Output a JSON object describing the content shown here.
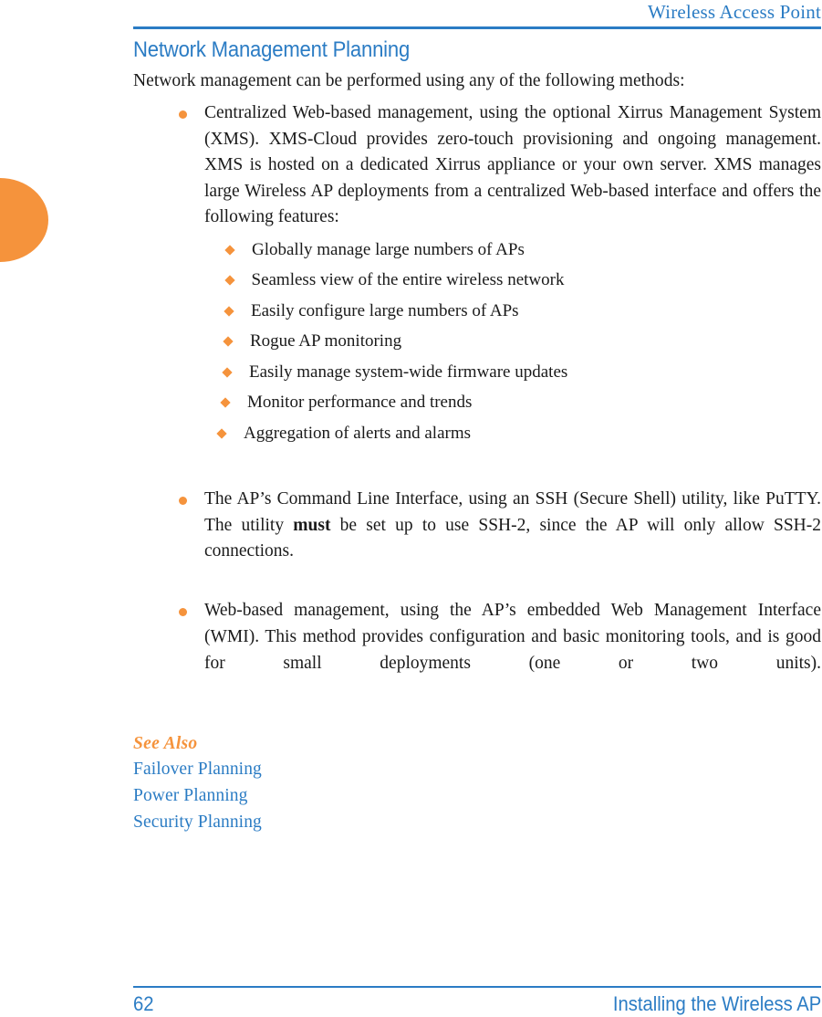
{
  "header": {
    "running_title": "Wireless Access Point"
  },
  "section": {
    "title": "Network Management Planning",
    "intro": "Network management can be performed using any of the following methods:"
  },
  "bullets": [
    {
      "text_before_bold": "Centralized Web-based management, using the optional Xirrus Management System (XMS). XMS-Cloud provides zero-touch provisioning and ongoing management. XMS is hosted on a dedicated Xirrus appliance or your own server. XMS manages large Wireless AP deployments from a centralized Web-based interface and offers the following features:",
      "bold": "",
      "text_after_bold": ""
    },
    {
      "text_before_bold": "The AP’s Command Line Interface, using an SSH (Secure Shell) utility, like PuTTY. The utility ",
      "bold": "must",
      "text_after_bold": " be set up to use SSH-2, since the AP will only allow SSH-2 connections."
    },
    {
      "text_before_bold": "Web-based management, using the AP’s embedded Web Management Interface (WMI). This method provides configuration and basic monitoring tools, and is good for small deployments (one or two units).",
      "bold": "",
      "text_after_bold": ""
    }
  ],
  "sub_bullets": [
    "Globally manage large numbers of APs",
    "Seamless view of the entire wireless network",
    "Easily configure large numbers of APs",
    "Rogue AP monitoring",
    "Easily manage system-wide firmware updates",
    "Monitor performance and trends",
    "Aggregation of alerts and alarms"
  ],
  "see_also": {
    "label": "See Also",
    "links": [
      "Failover Planning",
      "Power Planning",
      "Security Planning"
    ]
  },
  "footer": {
    "page_number": "62",
    "chapter": "Installing the Wireless AP"
  },
  "colors": {
    "accent_orange": "#f5933c",
    "link_blue": "#2b7cc4",
    "body_text": "#1a1a1a"
  }
}
